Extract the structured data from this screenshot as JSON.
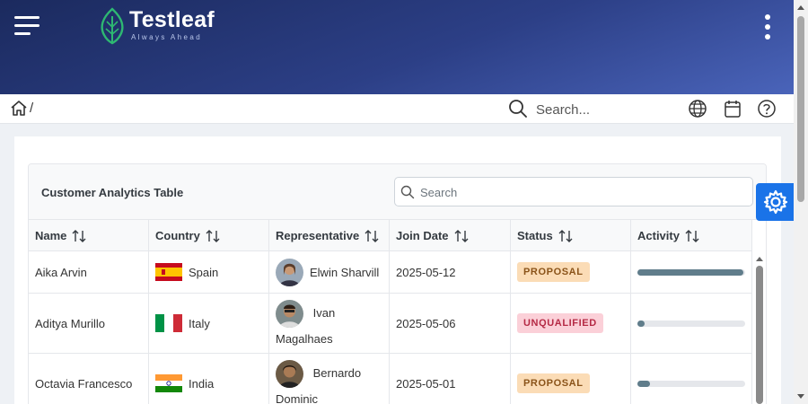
{
  "brand": {
    "name": "Testleaf",
    "tagline": "Always Ahead",
    "leaf_color": "#2eb872"
  },
  "topbar": {
    "menu_icon": "hamburger-icon",
    "more_icon": "kebab-icon"
  },
  "breadcrumb": {
    "home_icon": "home-icon",
    "separator": "/"
  },
  "global_search": {
    "placeholder": "Search...",
    "value": ""
  },
  "toolbar_icons": [
    "globe-icon",
    "calendar-icon",
    "help-icon"
  ],
  "table": {
    "title": "Customer Analytics Table",
    "search_placeholder": "Search",
    "columns": [
      "Name",
      "Country",
      "Representative",
      "Join Date",
      "Status",
      "Activity"
    ],
    "rows": [
      {
        "name": "Aika Arvin",
        "country": "Spain",
        "flag": "spain",
        "representative": "Elwin Sharvill",
        "rep_line1": "Elwin Sharvill",
        "rep_line2": "",
        "join_date": "2025-05-12",
        "status": "PROPOSAL",
        "activity": 0.98
      },
      {
        "name": "Aditya Murillo",
        "country": "Italy",
        "flag": "italy",
        "representative": "Ivan Magalhaes",
        "rep_line1": "Ivan",
        "rep_line2": "Magalhaes",
        "join_date": "2025-05-06",
        "status": "UNQUALIFIED",
        "activity": 0.07
      },
      {
        "name": "Octavia Francesco",
        "country": "India",
        "flag": "india",
        "representative": "Bernardo Dominic",
        "rep_line1": "Bernardo",
        "rep_line2": "Dominic",
        "join_date": "2025-05-01",
        "status": "PROPOSAL",
        "activity": 0.12
      }
    ]
  },
  "colors": {
    "accent": "#1a73e8",
    "header_start": "#1b2a5e",
    "header_end": "#4a64ba",
    "progress": "#607d8b"
  },
  "settings_icon": "gear-icon"
}
